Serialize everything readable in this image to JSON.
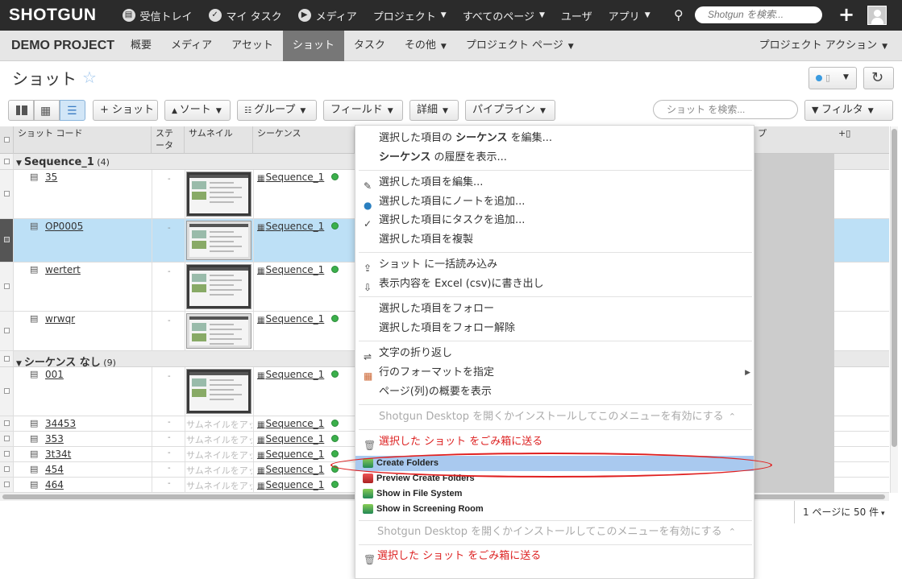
{
  "topbar": {
    "logo": "SHOTGUN",
    "nav": [
      {
        "icon": "inbox-icon",
        "label": "受信トレイ",
        "caret": false
      },
      {
        "icon": "check-circle-icon",
        "label": "マイ タスク",
        "caret": false
      },
      {
        "icon": "play-circle-icon",
        "label": "メディア",
        "caret": false
      },
      {
        "icon": "",
        "label": "プロジェクト",
        "caret": true
      },
      {
        "icon": "",
        "label": "すべてのページ",
        "caret": true
      },
      {
        "icon": "",
        "label": "ユーザ",
        "caret": false
      },
      {
        "icon": "",
        "label": "アプリ",
        "caret": true
      }
    ],
    "search_placeholder": "Shotgun を検索...",
    "plus": "+"
  },
  "projectbar": {
    "project": "DEMO PROJECT",
    "tabs": [
      "概要",
      "メディア",
      "アセット",
      "ショット",
      "タスク",
      "その他",
      "プロジェクト ページ"
    ],
    "active_tab": "ショット",
    "actions": "プロジェクト アクション"
  },
  "page": {
    "title": "ショット"
  },
  "toolbar": {
    "add_shot": "+ ショット",
    "sort": "ソート",
    "group": "グループ",
    "fields": "フィールド",
    "detail": "詳細",
    "pipeline": "パイプライン",
    "search_placeholder": "ショット を検索...",
    "filter": "フィルタ"
  },
  "grid": {
    "headers": {
      "code": "ショット コード",
      "status": "ステータス",
      "thumbnail": "サムネイル",
      "sequence": "シーケンス",
      "type_partial": "プ"
    },
    "groups": [
      {
        "name": "Sequence_1",
        "count": "(4)"
      },
      {
        "name": "シーケンス なし",
        "count": "(9)"
      }
    ],
    "status_dash": "-",
    "no_thumb_text": "サムネイルをアップロード",
    "sequence_value": "Sequence_1",
    "rows": [
      {
        "code": "35"
      },
      {
        "code": "OP0005"
      },
      {
        "code": "wertert"
      },
      {
        "code": "wrwqr"
      },
      {
        "code": "001"
      },
      {
        "code": "34453"
      },
      {
        "code": "353"
      },
      {
        "code": "3t34t"
      },
      {
        "code": "454"
      },
      {
        "code": "464"
      }
    ],
    "pager": "1 ページに 50 件"
  },
  "context_menu": {
    "edit_seq_prefix": "選択した項目の ",
    "edit_seq_bold": "シーケンス",
    "edit_seq_suffix": " を編集...",
    "history_bold": "シーケンス",
    "history_suffix": " の履歴を表示...",
    "edit_selected": "選択した項目を編集...",
    "add_note": "選択した項目にノートを追加...",
    "add_task": "選択した項目にタスクを追加...",
    "duplicate": "選択した項目を複製",
    "import": "ショット に一括読み込み",
    "export": "表示内容を Excel (csv)に書き出し",
    "follow": "選択した項目をフォロー",
    "unfollow": "選択した項目をフォロー解除",
    "wrap": "文字の折り返し",
    "format_rows": "行のフォーマットを指定",
    "summary": "ページ(列)の概要を表示",
    "desktop_notice": "Shotgun Desktop を開くかインストールしてこのメニューを有効にする",
    "trash": "選択した ショット をごみ箱に送る",
    "create_folders": "Create Folders",
    "preview_create_folders": "Preview Create Folders",
    "show_fs": "Show in File System",
    "show_screening": "Show in Screening Room",
    "desktop_notice2": "Shotgun Desktop を開くかインストールしてこのメニューを有効にする",
    "trash2": "選択した ショット をごみ箱に送る"
  }
}
